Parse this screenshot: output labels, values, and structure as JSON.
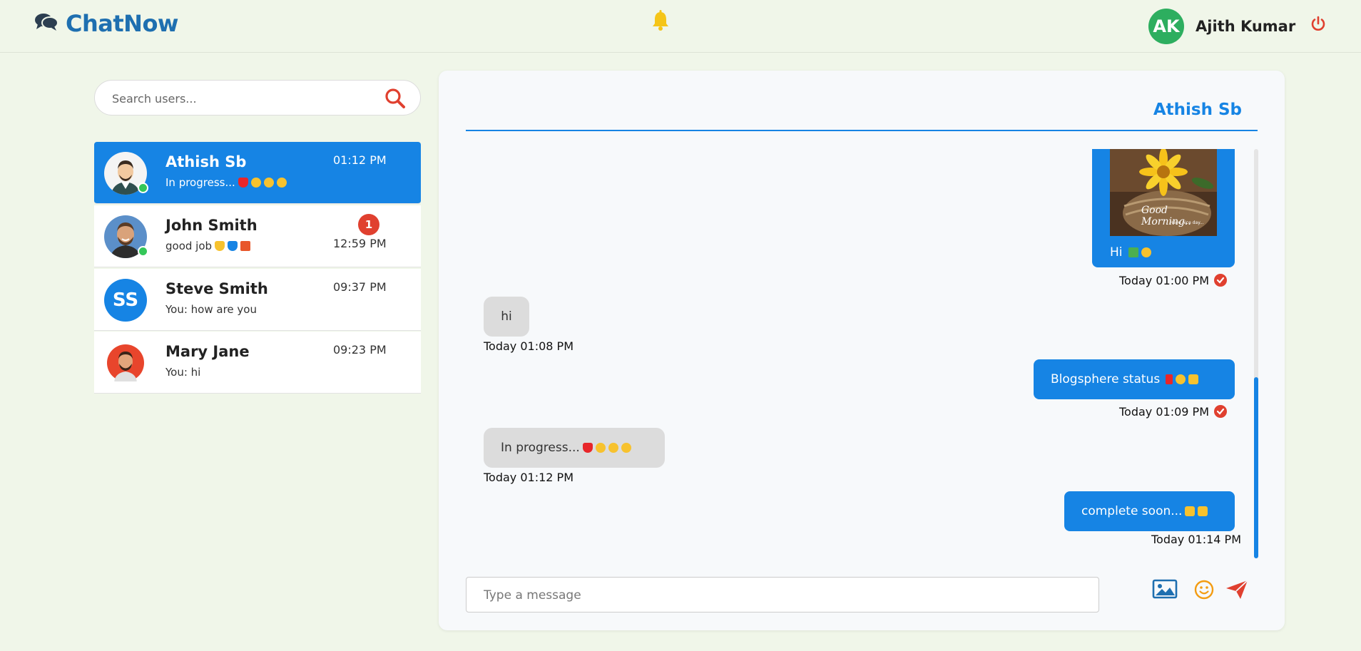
{
  "app": {
    "name": "ChatNow"
  },
  "user": {
    "initials": "AK",
    "name": "Ajith Kumar"
  },
  "search": {
    "placeholder": "Search users..."
  },
  "contacts": [
    {
      "name": "Athish Sb",
      "preview": "In progress...",
      "time": "01:12 PM",
      "online": true,
      "active": true
    },
    {
      "name": "John Smith",
      "preview": "good job",
      "time": "12:59 PM",
      "online": true,
      "unread": "1"
    },
    {
      "name": "Steve Smith",
      "initials": "SS",
      "preview": "You: how are you",
      "time": "09:37 PM"
    },
    {
      "name": "Mary Jane",
      "preview": "You: hi",
      "time": "09:23 PM"
    }
  ],
  "chat": {
    "title": "Athish Sb",
    "messages": [
      {
        "dir": "out",
        "text": "Hi",
        "image_caption": "Good Morning..",
        "image_subcaption": "Have nice day...",
        "time": "Today 01:00 PM",
        "read": true
      },
      {
        "dir": "in",
        "text": "hi",
        "time": "Today 01:08 PM"
      },
      {
        "dir": "out",
        "text": "Blogsphere status",
        "time": "Today 01:09 PM",
        "read": true
      },
      {
        "dir": "in",
        "text": "In progress...",
        "time": "Today 01:12 PM"
      },
      {
        "dir": "out",
        "text": "complete soon...",
        "time": "Today 01:14 PM"
      }
    ]
  },
  "compose": {
    "placeholder": "Type a message"
  },
  "icons": [
    "chat-bubbles-icon",
    "bell-icon",
    "power-icon",
    "search-icon",
    "image-icon",
    "emoji-icon",
    "send-icon",
    "read-check-icon"
  ],
  "colors": {
    "brand": "#1e6fb0",
    "accent": "#1684e4",
    "danger": "#e0402f",
    "online": "#34c759",
    "bell": "#f5c518",
    "background": "#f0f6e9"
  }
}
